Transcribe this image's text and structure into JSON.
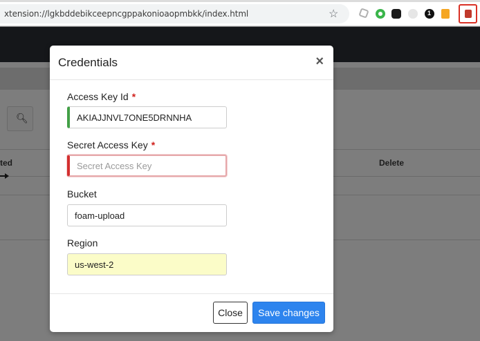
{
  "browser": {
    "url": "xtension://lgkbddebikceepncgppakonioaopmbkk/index.html",
    "ext5_label": "1"
  },
  "page": {
    "col_left": "ted",
    "col_delete": "Delete"
  },
  "modal": {
    "title": "Credentials",
    "close_symbol": "×",
    "fields": {
      "access_key": {
        "label": "Access Key Id",
        "required": "*",
        "value": "AKIAJJNVL7ONE5DRNNHA"
      },
      "secret_key": {
        "label": "Secret Access Key",
        "required": "*",
        "value": "",
        "placeholder": "Secret Access Key"
      },
      "bucket": {
        "label": "Bucket",
        "value": "foam-upload"
      },
      "region": {
        "label": "Region",
        "value": "us-west-2"
      }
    },
    "buttons": {
      "close": "Close",
      "save": "Save changes"
    }
  },
  "colors": {
    "primary": "#2d84ee",
    "valid": "#43a047",
    "invalid": "#d32f2f",
    "required": "#d0211c"
  }
}
